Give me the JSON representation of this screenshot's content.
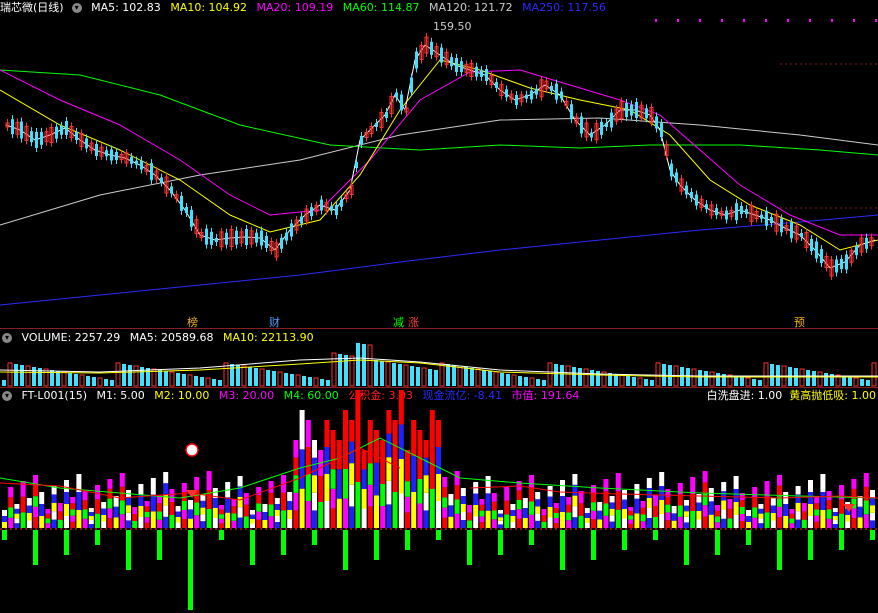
{
  "main": {
    "stock_name": "瑞芯微(日线)",
    "ma": [
      {
        "label": "MA5: 102.83",
        "color": "#ffffff"
      },
      {
        "label": "MA10: 104.92",
        "color": "#ffff00"
      },
      {
        "label": "MA20: 109.19",
        "color": "#ff00ff"
      },
      {
        "label": "MA60: 114.87",
        "color": "#00ff00"
      },
      {
        "label": "MA120: 121.72",
        "color": "#cccccc"
      },
      {
        "label": "MA250: 117.56",
        "color": "#2b2bff"
      }
    ],
    "high_label": "159.50",
    "events": [
      {
        "text": "榜",
        "color": "#f0b020"
      },
      {
        "text": "财",
        "color": "#4aa0ff"
      },
      {
        "text": "减",
        "color": "#00ff00"
      },
      {
        "text": "涨",
        "color": "#ff4040"
      },
      {
        "text": "预",
        "color": "#f0b020"
      }
    ]
  },
  "volume": {
    "label": "VOLUME: 2257.29",
    "ma5": "MA5: 20589.68",
    "ma10": "MA10: 22113.90"
  },
  "indicator": {
    "name": "FT-L001(15)",
    "m1": "M1: 5.00",
    "m2": "M2: 10.00",
    "m3": "M3: 20.00",
    "m4": "M4: 60.00",
    "gjj": "公积金: 3.03",
    "xjsz": "现金流亿: -8.41",
    "sz": "市值: 191.64",
    "right1": "白洗盘进: 1.00",
    "right2": "黄高抛低吸: 1.00",
    "colors": {
      "red": "#ff0000",
      "yellow": "#ffff00",
      "magenta": "#ff00ff",
      "blue": "#2020ff",
      "green": "#00ff00",
      "white": "#ffffff"
    }
  }
}
